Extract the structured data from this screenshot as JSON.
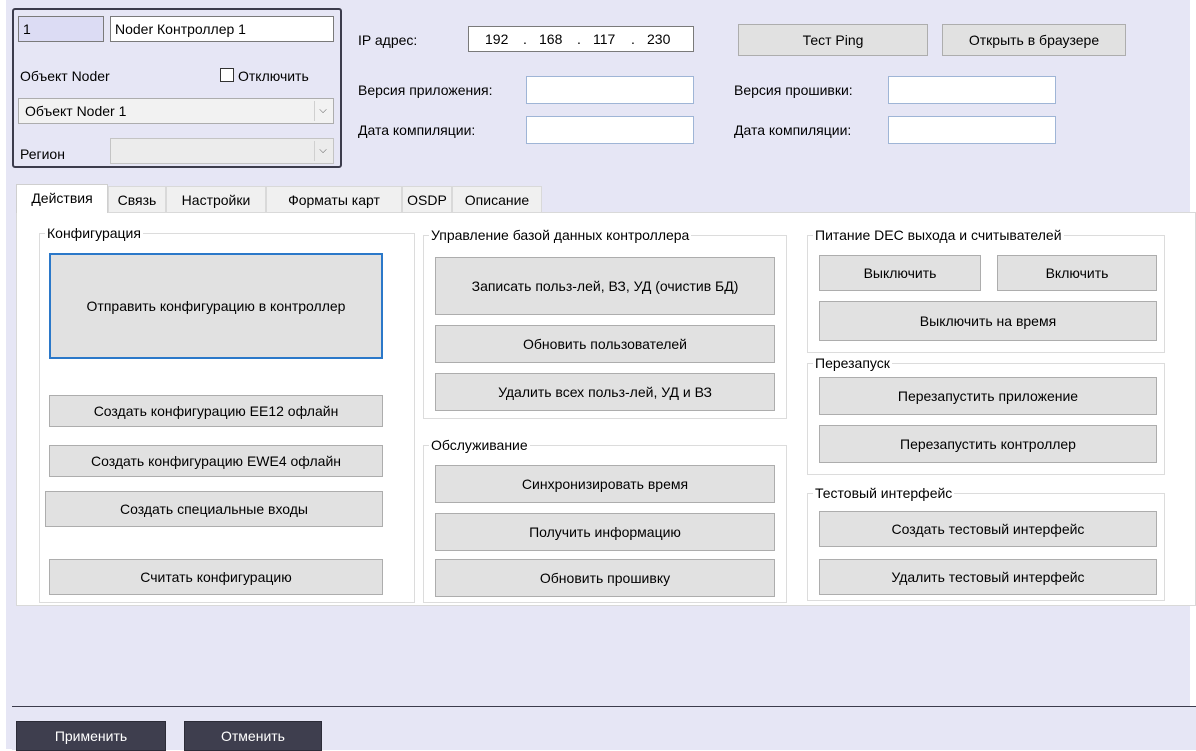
{
  "device": {
    "number": "1",
    "name": "Noder Контроллер 1",
    "object_label": "Объект Noder",
    "disable_label": "Отключить",
    "disable_checked": false,
    "object_value": "Объект Noder 1",
    "region_label": "Регион",
    "region_value": ""
  },
  "network": {
    "ip_label": "IP адрес:",
    "ip_octets": [
      "192",
      "168",
      "117",
      "230"
    ],
    "ip_separator": ".",
    "ping_button": "Тест Ping",
    "open_browser_button": "Открыть в браузере",
    "app_version_label": "Версия приложения:",
    "app_version_value": "",
    "app_compile_label": "Дата компиляции:",
    "app_compile_value": "",
    "fw_version_label": "Версия прошивки:",
    "fw_version_value": "",
    "fw_compile_label": "Дата компиляции:",
    "fw_compile_value": ""
  },
  "tabs": [
    "Действия",
    "Связь",
    "Настройки",
    "Форматы карт",
    "OSDP",
    "Описание"
  ],
  "active_tab": "Действия",
  "config_group": {
    "title": "Конфигурация",
    "send_button": "Отправить конфигурацию в контроллер",
    "ee12_button": "Создать конфигурацию EE12 офлайн",
    "ewe4_button": "Создать конфигурацию EWE4 офлайн",
    "special_inputs_button": "Создать специальные входы",
    "read_button": "Считать конфигурацию"
  },
  "db_group": {
    "title": "Управление базой данных контроллера",
    "write_button": "Записать польз-лей, ВЗ, УД (очистив БД)",
    "update_users_button": "Обновить пользователей",
    "delete_all_button": "Удалить всех польз-лей, УД и ВЗ"
  },
  "service_group": {
    "title": "Обслуживание",
    "sync_time_button": "Синхронизировать время",
    "get_info_button": "Получить информацию",
    "update_fw_button": "Обновить прошивку"
  },
  "power_group": {
    "title": "Питание DEC выхода и считывателей",
    "off_button": "Выключить",
    "on_button": "Включить",
    "off_timed_button": "Выключить на время"
  },
  "restart_group": {
    "title": "Перезапуск",
    "restart_app_button": "Перезапустить приложение",
    "restart_controller_button": "Перезапустить контроллер"
  },
  "test_group": {
    "title": "Тестовый интерфейс",
    "create_button": "Создать тестовый интерфейс",
    "delete_button": "Удалить тестовый интерфейс"
  },
  "footer": {
    "apply_button": "Применить",
    "cancel_button": "Отменить"
  },
  "colors": {
    "window_bg": "#e6e6f5",
    "focus_border": "#2b78c9",
    "footer_button_bg": "#3e3e4e"
  }
}
